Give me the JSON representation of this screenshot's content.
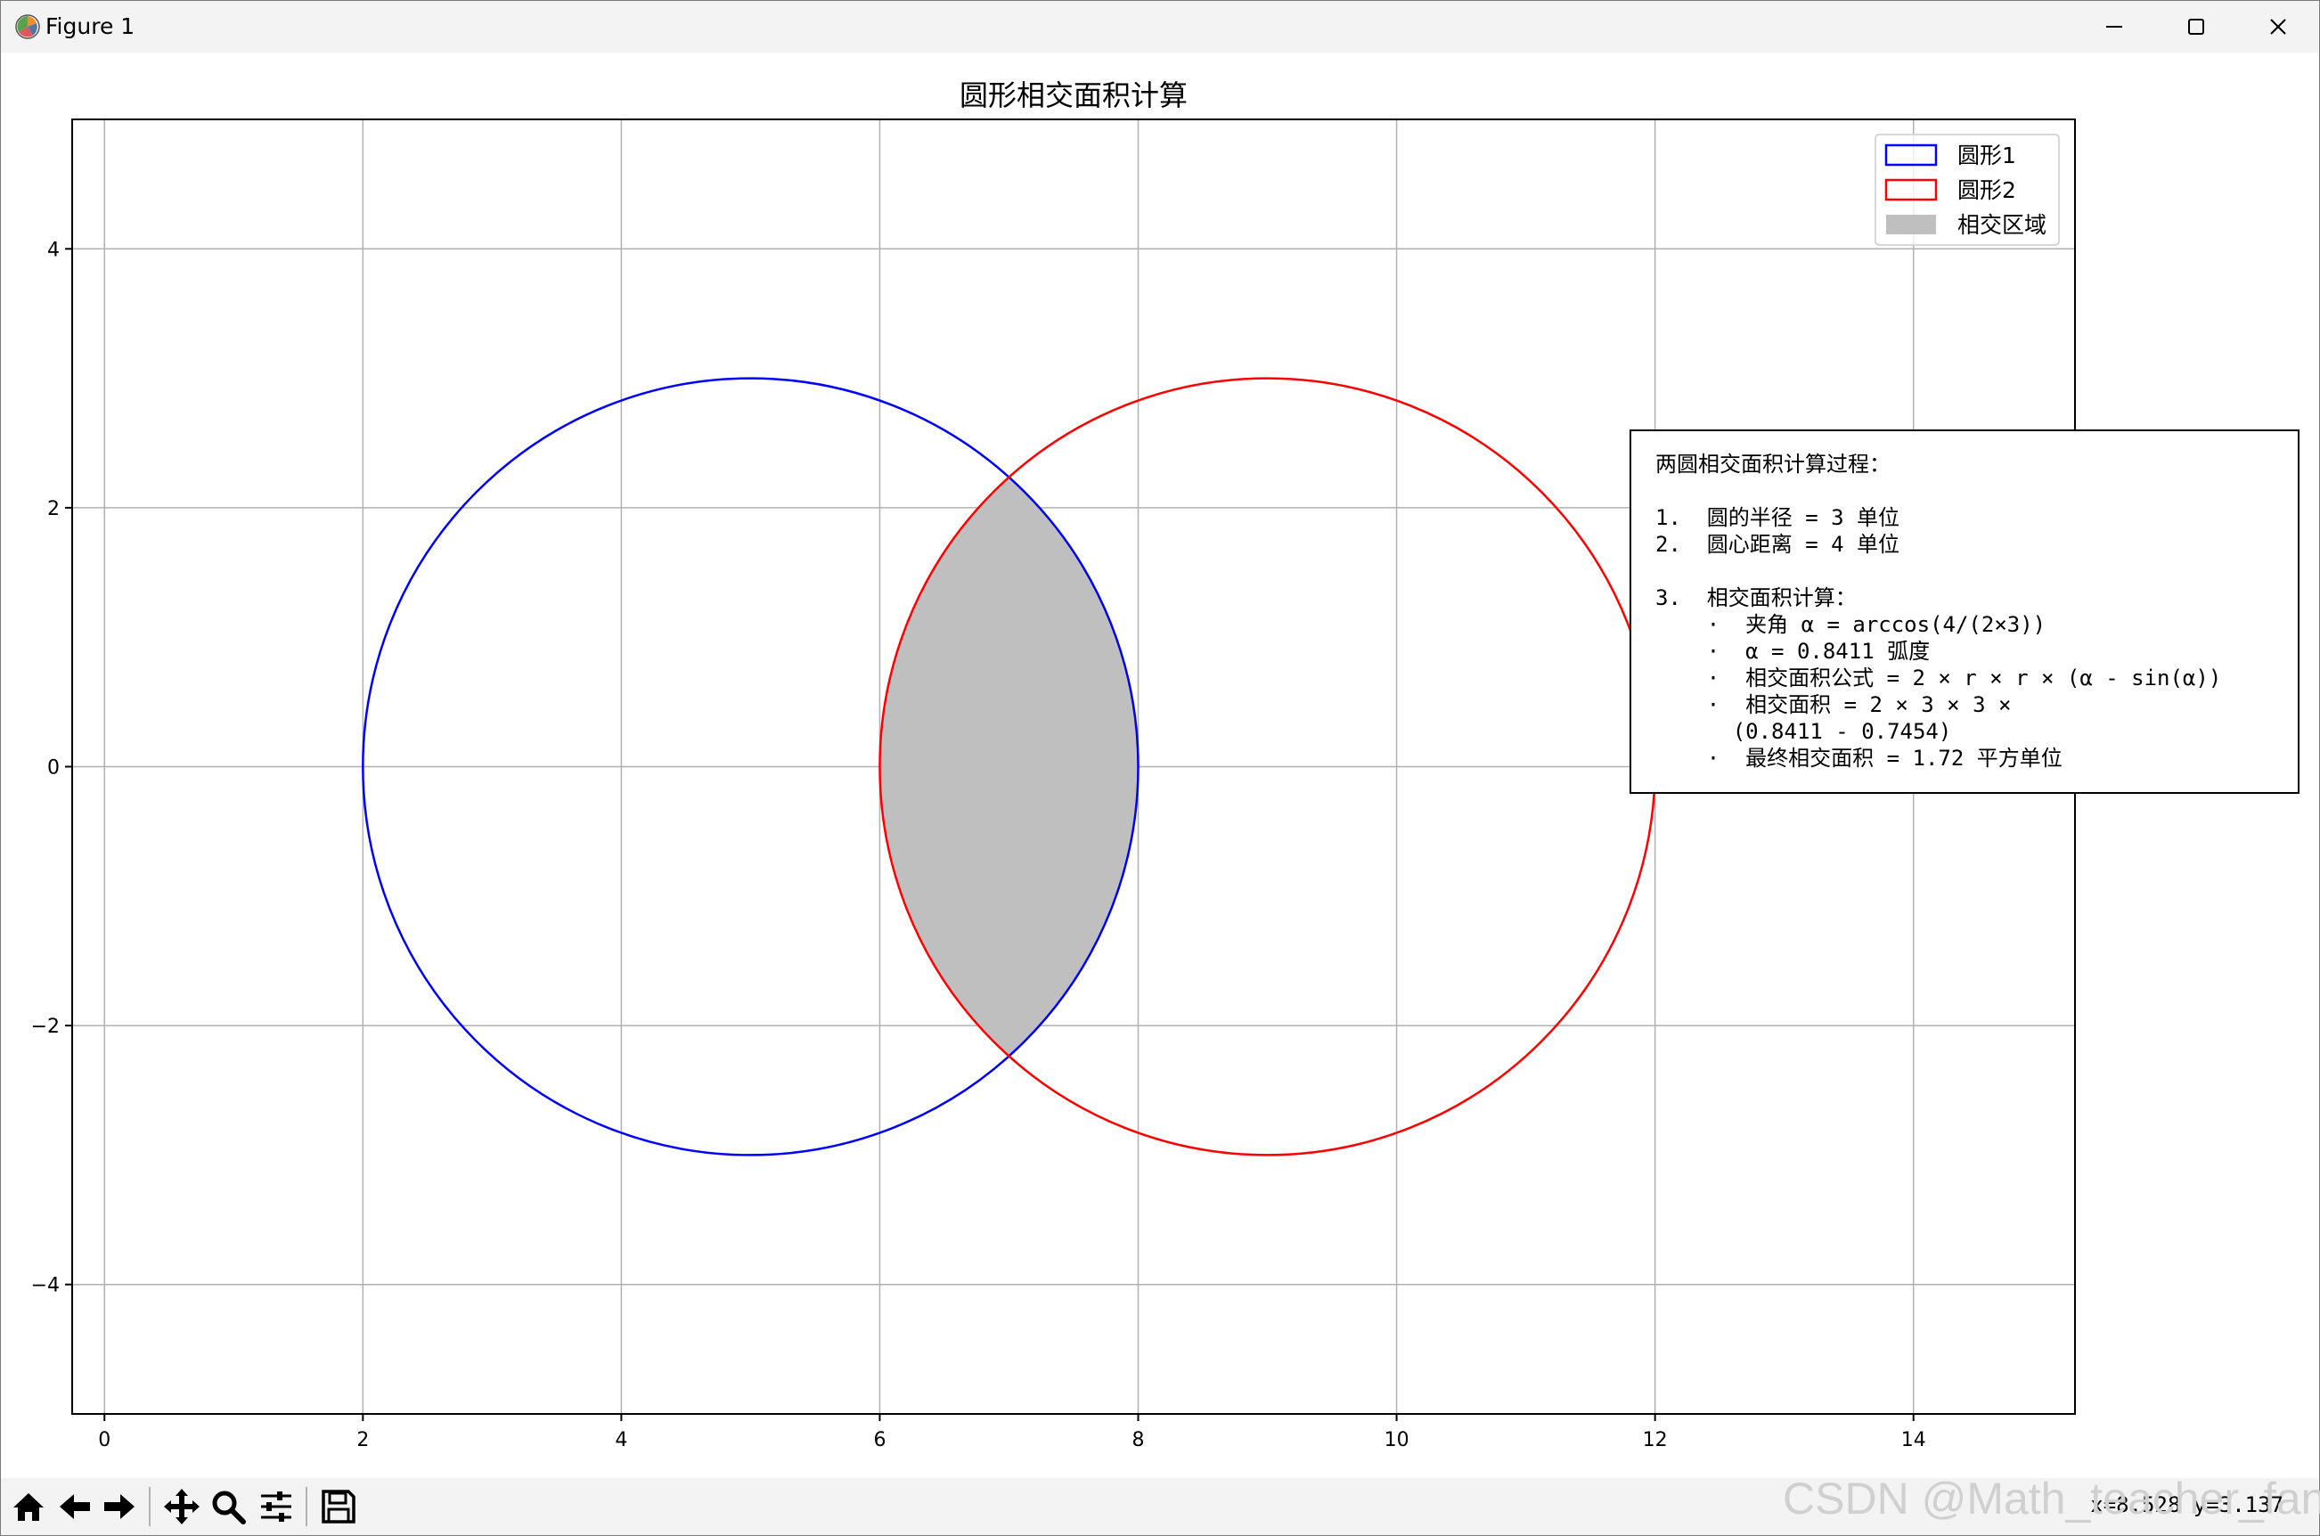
{
  "window": {
    "title": "Figure 1",
    "controls": {
      "minimize": "minimize-icon",
      "maximize": "maximize-icon",
      "close": "close-icon"
    }
  },
  "chart_data": {
    "type": "line",
    "title": "圆形相交面积计算",
    "xlabel": "",
    "ylabel": "",
    "xlim": [
      -0.25,
      15.25
    ],
    "ylim": [
      -5,
      5
    ],
    "grid": true,
    "x_ticks": [
      0,
      2,
      4,
      6,
      8,
      10,
      12,
      14
    ],
    "y_ticks": [
      -4,
      -2,
      0,
      2,
      4
    ],
    "x_tick_labels": [
      "0",
      "2",
      "4",
      "6",
      "8",
      "10",
      "12",
      "14"
    ],
    "y_tick_labels": [
      "−4",
      "−2",
      "0",
      "2",
      "4"
    ],
    "circles": [
      {
        "name": "圆形1",
        "center": [
          5,
          0
        ],
        "radius": 3,
        "color": "#0000ff"
      },
      {
        "name": "圆形2",
        "center": [
          9,
          0
        ],
        "radius": 3,
        "color": "#ff0000"
      }
    ],
    "intersection": {
      "name": "相交区域",
      "color": "#bfbfbf",
      "x_range": [
        6,
        8
      ]
    },
    "legend": {
      "placement": "top-right",
      "entries": [
        {
          "label": "圆形1",
          "color": "#0000ff",
          "style": "outline"
        },
        {
          "label": "圆形2",
          "color": "#ff0000",
          "style": "outline"
        },
        {
          "label": "相交区域",
          "color": "#bfbfbf",
          "style": "fill"
        }
      ]
    },
    "annotation": {
      "lines": [
        "两圆相交面积计算过程：",
        "",
        "1.  圆的半径 = 3 单位",
        "2.  圆心距离 = 4 单位",
        "",
        "3.  相交面积计算：",
        "    ·  夹角 α = arccos(4/(2×3))",
        "    ·  α = 0.8411 弧度",
        "    ·  相交面积公式 = 2 × r × r × (α - sin(α))",
        "    ·  相交面积 = 2 × 3 × 3 ×",
        "      (0.8411 - 0.7454)",
        "    ·  最终相交面积 = 1.72 平方单位"
      ]
    }
  },
  "toolbar": {
    "buttons": [
      {
        "name": "home-button",
        "icon": "home-icon"
      },
      {
        "name": "back-button",
        "icon": "arrow-left-icon"
      },
      {
        "name": "forward-button",
        "icon": "arrow-right-icon"
      },
      {
        "name": "pan-button",
        "icon": "move-icon"
      },
      {
        "name": "zoom-button",
        "icon": "magnifier-icon"
      },
      {
        "name": "configure-button",
        "icon": "sliders-icon"
      },
      {
        "name": "save-button",
        "icon": "floppy-disk-icon"
      }
    ],
    "coordinates": "x=8.528 y=3.137"
  },
  "watermark": "CSDN @Math_teacher_fan"
}
